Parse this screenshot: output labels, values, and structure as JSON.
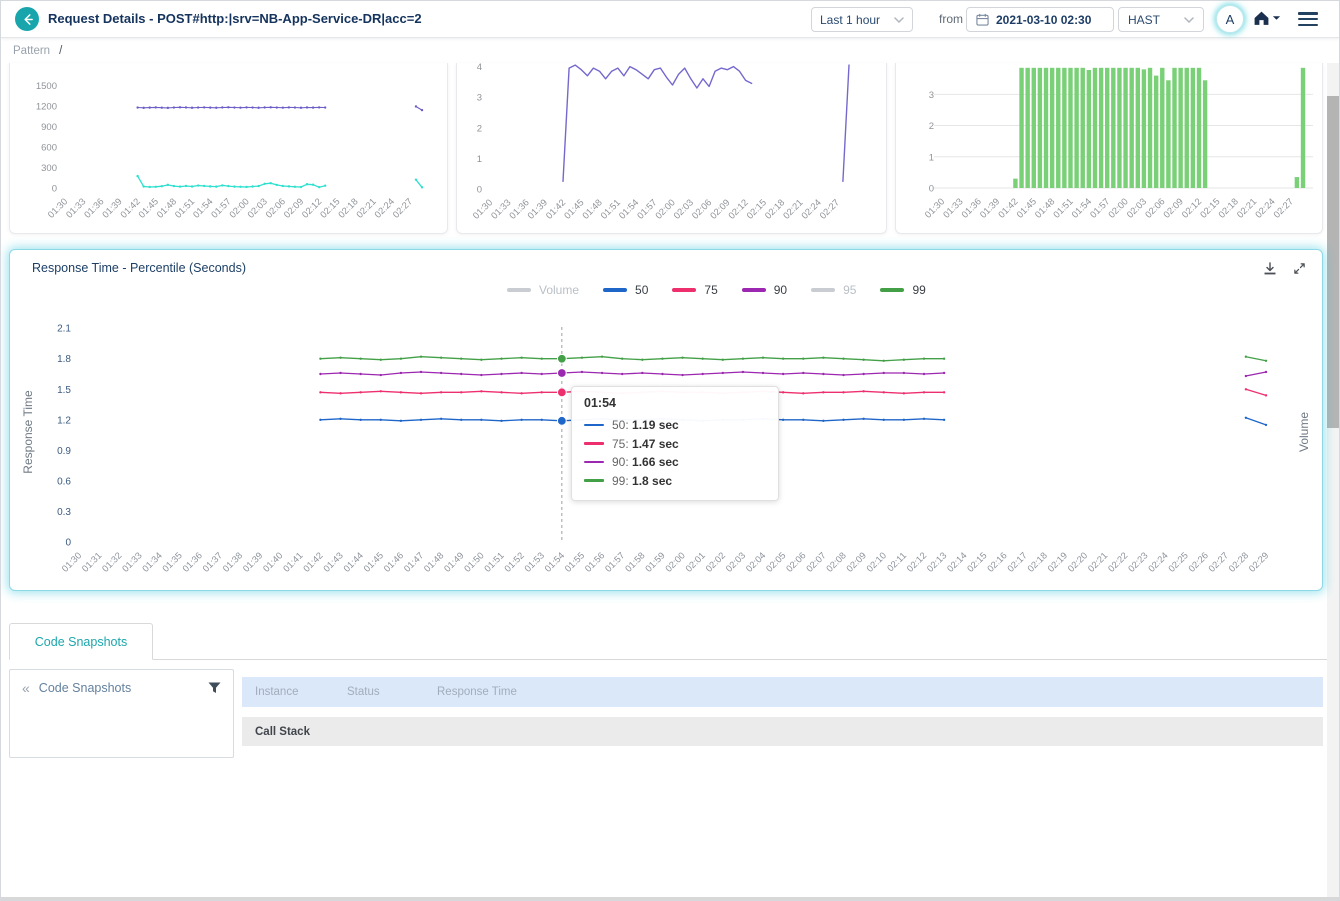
{
  "header": {
    "title": "Request Details - POST#http:|srv=NB-App-Service-DR|acc=2",
    "time_range": "Last 1 hour",
    "from_label": "from",
    "datetime": "2021-03-10 02:30",
    "timezone": "HAST",
    "avatar": "A"
  },
  "breadcrumb": {
    "section": "Pattern",
    "separator": "/"
  },
  "main_panel": {
    "legend": [
      {
        "label": "Volume",
        "color": "#c3c7cc",
        "disabled": true
      },
      {
        "label": "50",
        "color": "#1f66c9",
        "disabled": false
      },
      {
        "label": "75",
        "color": "#ee2f6e",
        "disabled": false
      },
      {
        "label": "90",
        "color": "#9c27b0",
        "disabled": false
      },
      {
        "label": "95",
        "color": "#c3c7cc",
        "disabled": true
      },
      {
        "label": "99",
        "color": "#43a047",
        "disabled": false
      }
    ],
    "tooltip": {
      "time": "01:54",
      "rows": [
        {
          "label": "50:",
          "value": "1.19 sec",
          "color": "#1f66c9"
        },
        {
          "label": "75:",
          "value": "1.47 sec",
          "color": "#ee2f6e"
        },
        {
          "label": "90:",
          "value": "1.66 sec",
          "color": "#9c27b0"
        },
        {
          "label": "99:",
          "value": "1.8 sec",
          "color": "#43a047"
        }
      ]
    }
  },
  "bottom": {
    "tab": "Code Snapshots",
    "collapse_icon": "«",
    "panel_title": "Code Snapshots",
    "table_headers": [
      "Instance",
      "Status",
      "Response Time"
    ],
    "call_stack": "Call Stack"
  },
  "timeline": [
    "01:30",
    "01:31",
    "01:32",
    "01:33",
    "01:34",
    "01:35",
    "01:36",
    "01:37",
    "01:38",
    "01:39",
    "01:40",
    "01:41",
    "01:42",
    "01:43",
    "01:44",
    "01:45",
    "01:46",
    "01:47",
    "01:48",
    "01:49",
    "01:50",
    "01:51",
    "01:52",
    "01:53",
    "01:54",
    "01:55",
    "01:56",
    "01:57",
    "01:58",
    "01:59",
    "02:00",
    "02:01",
    "02:02",
    "02:03",
    "02:04",
    "02:05",
    "02:06",
    "02:07",
    "02:08",
    "02:09",
    "02:10",
    "02:11",
    "02:12",
    "02:13",
    "02:14",
    "02:15",
    "02:16",
    "02:17",
    "02:18",
    "02:19",
    "02:20",
    "02:21",
    "02:22",
    "02:23",
    "02:24",
    "02:25",
    "02:26",
    "02:27",
    "02:28",
    "02:29"
  ],
  "chart_data": [
    {
      "id": "top-left",
      "type": "line",
      "x_ref": "timeline",
      "tick_every": 3,
      "ylim": [
        0,
        1760
      ],
      "yticks": [
        0,
        300,
        600,
        900,
        1200,
        1500
      ],
      "grid": false,
      "series": [
        {
          "name": "series-1",
          "color": "#6b5ec7",
          "lw": 1.1,
          "markers": true,
          "values": [
            null,
            null,
            null,
            null,
            null,
            null,
            null,
            null,
            null,
            null,
            null,
            null,
            1180,
            1176,
            1179,
            1182,
            1178,
            1175,
            1180,
            1183,
            1181,
            1177,
            1180,
            1182,
            1179,
            1177,
            1181,
            1184,
            1180,
            1178,
            1182,
            1180,
            1177,
            1181,
            1183,
            1180,
            1178,
            1182,
            1180,
            1177,
            1181,
            1179,
            1182,
            1180,
            null,
            null,
            null,
            null,
            null,
            null,
            null,
            null,
            null,
            null,
            null,
            null,
            null,
            null,
            1196,
            1142
          ]
        },
        {
          "name": "series-2",
          "color": "#2fe0cf",
          "lw": 1.3,
          "markers": true,
          "values": [
            null,
            null,
            null,
            null,
            null,
            null,
            null,
            null,
            null,
            null,
            null,
            null,
            175,
            22,
            15,
            18,
            26,
            46,
            28,
            20,
            30,
            22,
            36,
            30,
            24,
            20,
            38,
            28,
            20,
            18,
            15,
            22,
            28,
            62,
            70,
            45,
            30,
            24,
            18,
            14,
            55,
            48,
            12,
            34,
            null,
            null,
            null,
            null,
            null,
            null,
            null,
            null,
            null,
            null,
            null,
            null,
            null,
            null,
            122,
            10
          ]
        }
      ]
    },
    {
      "id": "top-middle",
      "type": "line",
      "x_ref": "timeline",
      "tick_every": 3,
      "ylim": [
        0,
        4.15
      ],
      "yticks": [
        0,
        1,
        2,
        3,
        4
      ],
      "grid": false,
      "series": [
        {
          "name": "series-1",
          "color": "#7468cd",
          "lw": 1.4,
          "markers": false,
          "values": [
            null,
            null,
            null,
            null,
            null,
            null,
            null,
            null,
            null,
            null,
            null,
            null,
            0.25,
            3.95,
            4.05,
            3.9,
            3.7,
            3.95,
            3.85,
            3.6,
            3.85,
            3.95,
            3.7,
            4.0,
            3.9,
            3.75,
            3.6,
            3.9,
            3.95,
            3.65,
            3.4,
            3.75,
            3.95,
            3.6,
            3.3,
            3.6,
            3.35,
            3.85,
            3.95,
            3.9,
            4.0,
            3.85,
            3.55,
            3.45,
            null,
            null,
            null,
            null,
            null,
            null,
            null,
            null,
            null,
            null,
            null,
            null,
            null,
            null,
            0.25,
            4.05
          ]
        }
      ]
    },
    {
      "id": "top-right",
      "type": "bar",
      "x_ref": "timeline",
      "tick_every": 3,
      "ylim": [
        0,
        4.1
      ],
      "yticks": [
        0,
        1,
        2,
        3
      ],
      "grid": true,
      "series": [
        {
          "name": "series-1",
          "color": "#79d077",
          "values": [
            null,
            null,
            null,
            null,
            null,
            null,
            null,
            null,
            null,
            null,
            null,
            null,
            0.3,
            3.85,
            3.85,
            3.85,
            3.85,
            3.85,
            3.85,
            3.85,
            3.85,
            3.85,
            3.85,
            3.85,
            3.78,
            3.85,
            3.85,
            3.85,
            3.85,
            3.85,
            3.85,
            3.85,
            3.85,
            3.8,
            3.85,
            3.6,
            3.85,
            3.45,
            3.85,
            3.85,
            3.85,
            3.85,
            3.85,
            3.45,
            null,
            null,
            null,
            null,
            null,
            null,
            null,
            null,
            null,
            null,
            null,
            null,
            null,
            null,
            0.35,
            3.85
          ]
        }
      ]
    },
    {
      "id": "main-percentile",
      "type": "line",
      "x_ref": "timeline",
      "tick_every": 1,
      "title": "Response Time - Percentile (Seconds)",
      "ylabel": "Response Time",
      "y2label": "Volume",
      "ylim": [
        0,
        2.2
      ],
      "yticks": [
        0,
        0.3,
        0.6,
        0.9,
        1.2,
        1.5,
        1.8,
        2.1
      ],
      "grid": false,
      "highlight_x": "01:54",
      "series": [
        {
          "name": "50",
          "color": "#1f66c9",
          "lw": 1.3,
          "markers": true,
          "values": [
            null,
            null,
            null,
            null,
            null,
            null,
            null,
            null,
            null,
            null,
            null,
            null,
            1.2,
            1.21,
            1.2,
            1.2,
            1.19,
            1.2,
            1.21,
            1.2,
            1.2,
            1.19,
            1.2,
            1.2,
            1.19,
            1.2,
            1.21,
            1.2,
            1.2,
            1.21,
            1.2,
            1.19,
            1.2,
            1.2,
            1.21,
            1.2,
            1.2,
            1.19,
            1.2,
            1.21,
            1.2,
            1.2,
            1.21,
            1.2,
            null,
            null,
            null,
            null,
            null,
            null,
            null,
            null,
            null,
            null,
            null,
            null,
            null,
            null,
            1.22,
            1.15
          ]
        },
        {
          "name": "75",
          "color": "#ee2f6e",
          "lw": 1.3,
          "markers": true,
          "values": [
            null,
            null,
            null,
            null,
            null,
            null,
            null,
            null,
            null,
            null,
            null,
            null,
            1.47,
            1.46,
            1.47,
            1.48,
            1.47,
            1.46,
            1.47,
            1.47,
            1.48,
            1.47,
            1.46,
            1.47,
            1.47,
            1.48,
            1.47,
            1.46,
            1.47,
            1.48,
            1.47,
            1.47,
            1.46,
            1.47,
            1.48,
            1.47,
            1.46,
            1.47,
            1.47,
            1.48,
            1.47,
            1.46,
            1.47,
            1.47,
            null,
            null,
            null,
            null,
            null,
            null,
            null,
            null,
            null,
            null,
            null,
            null,
            null,
            null,
            1.5,
            1.44
          ]
        },
        {
          "name": "90",
          "color": "#9c27b0",
          "lw": 1.3,
          "markers": true,
          "values": [
            null,
            null,
            null,
            null,
            null,
            null,
            null,
            null,
            null,
            null,
            null,
            null,
            1.65,
            1.66,
            1.65,
            1.64,
            1.66,
            1.67,
            1.66,
            1.65,
            1.64,
            1.65,
            1.66,
            1.65,
            1.66,
            1.67,
            1.66,
            1.65,
            1.66,
            1.65,
            1.64,
            1.65,
            1.66,
            1.67,
            1.66,
            1.65,
            1.66,
            1.65,
            1.64,
            1.65,
            1.66,
            1.66,
            1.65,
            1.66,
            null,
            null,
            null,
            null,
            null,
            null,
            null,
            null,
            null,
            null,
            null,
            null,
            null,
            null,
            1.63,
            1.67
          ]
        },
        {
          "name": "99",
          "color": "#43a047",
          "lw": 1.3,
          "markers": true,
          "values": [
            null,
            null,
            null,
            null,
            null,
            null,
            null,
            null,
            null,
            null,
            null,
            null,
            1.8,
            1.81,
            1.8,
            1.79,
            1.8,
            1.82,
            1.81,
            1.8,
            1.79,
            1.8,
            1.81,
            1.8,
            1.8,
            1.81,
            1.82,
            1.8,
            1.79,
            1.8,
            1.81,
            1.8,
            1.79,
            1.8,
            1.81,
            1.8,
            1.8,
            1.81,
            1.8,
            1.79,
            1.78,
            1.79,
            1.8,
            1.8,
            null,
            null,
            null,
            null,
            null,
            null,
            null,
            null,
            null,
            null,
            null,
            null,
            null,
            null,
            1.82,
            1.78
          ]
        }
      ]
    }
  ]
}
